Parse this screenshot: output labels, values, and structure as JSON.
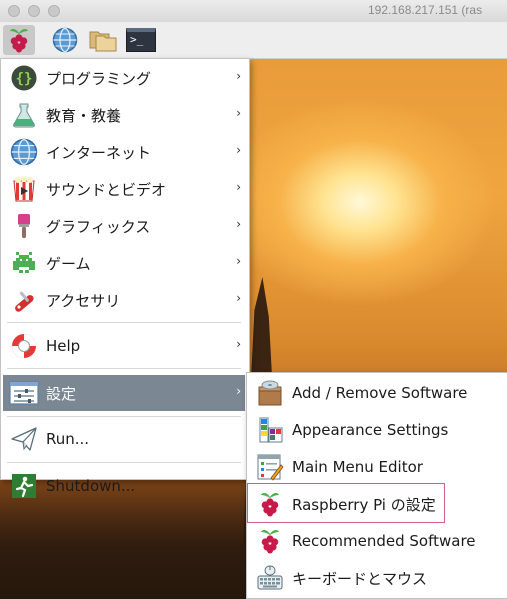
{
  "window": {
    "title": "192.168.217.151 (ras"
  },
  "taskbar": {
    "buttons": [
      {
        "icon": "raspberry-icon"
      },
      {
        "icon": "globe-icon"
      },
      {
        "icon": "folders-icon"
      },
      {
        "icon": "terminal-icon",
        "glyph": ">_"
      }
    ]
  },
  "main_menu": {
    "items": [
      {
        "label": "プログラミング",
        "icon": "programming-icon"
      },
      {
        "label": "教育・教養",
        "icon": "education-icon"
      },
      {
        "label": "インターネット",
        "icon": "globe-icon"
      },
      {
        "label": "サウンドとビデオ",
        "icon": "video-icon"
      },
      {
        "label": "グラフィックス",
        "icon": "paintbrush-icon"
      },
      {
        "label": "ゲーム",
        "icon": "game-icon"
      },
      {
        "label": "アクセサリ",
        "icon": "accessories-icon"
      },
      {
        "label": "Help",
        "icon": "lifebuoy-icon"
      },
      {
        "label": "設定",
        "icon": "preferences-icon"
      },
      {
        "label": "Run...",
        "icon": "paper-plane-icon"
      },
      {
        "label": "Shutdown...",
        "icon": "exit-icon"
      }
    ],
    "arrow": "›"
  },
  "sub_menu": {
    "items": [
      {
        "label": "Add / Remove Software",
        "icon": "package-icon"
      },
      {
        "label": "Appearance Settings",
        "icon": "swatches-icon"
      },
      {
        "label": "Main Menu Editor",
        "icon": "menu-editor-icon"
      },
      {
        "label": "Raspberry Pi の設定",
        "icon": "raspberry-icon"
      },
      {
        "label": "Recommended Software",
        "icon": "raspberry-icon"
      },
      {
        "label": "キーボードとマウス",
        "icon": "keyboard-mouse-icon"
      }
    ]
  },
  "colors": {
    "selected_row": "#7b8793",
    "highlight_border": "#d85c86",
    "raspberry": "#c51a4a",
    "leaf": "#4caf50"
  }
}
